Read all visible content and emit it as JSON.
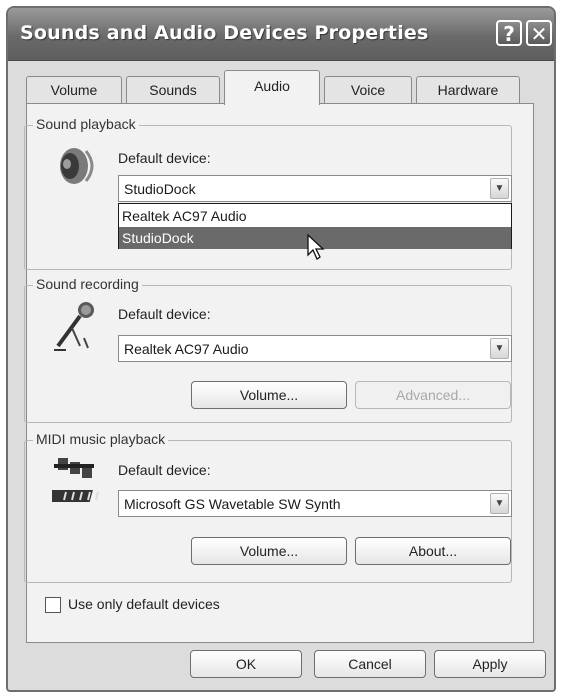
{
  "window": {
    "title": "Sounds and Audio Devices Properties",
    "help_label": "?",
    "close_label": "✕"
  },
  "tabs": [
    {
      "label": "Volume",
      "active": false
    },
    {
      "label": "Sounds",
      "active": false
    },
    {
      "label": "Audio",
      "active": true
    },
    {
      "label": "Voice",
      "active": false
    },
    {
      "label": "Hardware",
      "active": false
    }
  ],
  "playback": {
    "group_title": "Sound playback",
    "default_device_label": "Default device:",
    "selected": "StudioDock",
    "options": [
      "Realtek AC97 Audio",
      "StudioDock"
    ],
    "icon": "speaker-icon"
  },
  "recording": {
    "group_title": "Sound recording",
    "default_device_label": "Default device:",
    "selected": "Realtek AC97 Audio",
    "volume_label": "Volume...",
    "advanced_label": "Advanced...",
    "icon": "microphone-icon"
  },
  "midi": {
    "group_title": "MIDI music playback",
    "default_device_label": "Default device:",
    "selected": "Microsoft GS Wavetable SW Synth",
    "volume_label": "Volume...",
    "about_label": "About...",
    "icon": "midi-keyboard-icon"
  },
  "use_default_only": {
    "label": "Use only default devices",
    "checked": false
  },
  "footer": {
    "ok_label": "OK",
    "cancel_label": "Cancel",
    "apply_label": "Apply"
  }
}
